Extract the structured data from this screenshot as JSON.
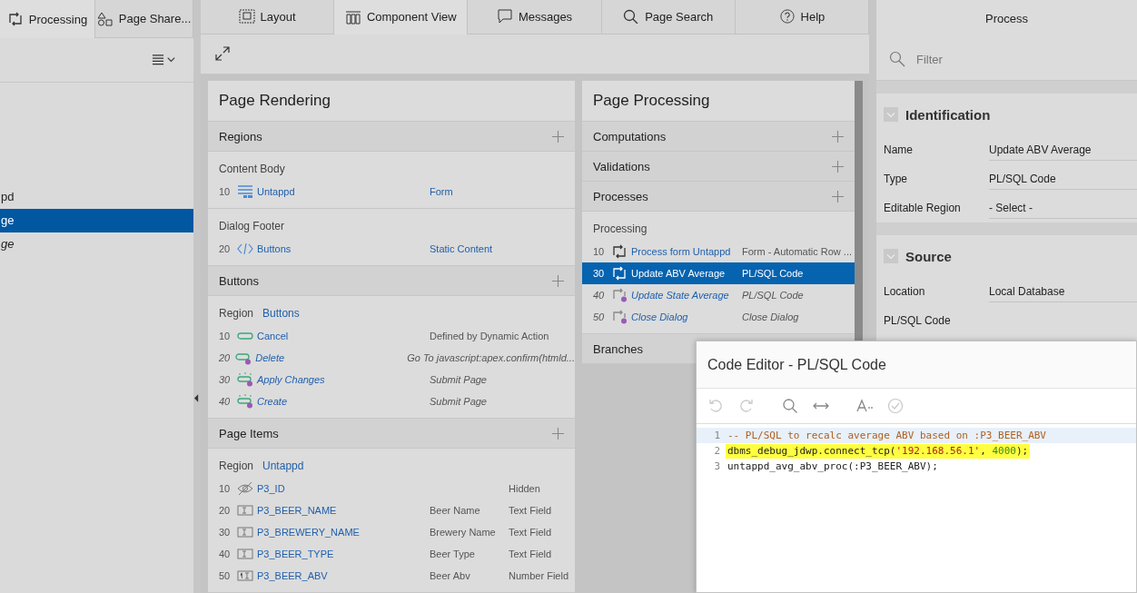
{
  "left_panel": {
    "tabs": [
      {
        "label": "Processing",
        "selected": true
      },
      {
        "label": "Page Share...",
        "selected": false
      }
    ],
    "tree_items": [
      {
        "label": "pd",
        "selected": false,
        "conditional": false
      },
      {
        "label": "ge",
        "selected": true,
        "conditional": false
      },
      {
        "label": "ge",
        "selected": false,
        "conditional": true
      }
    ]
  },
  "center_tabs": [
    {
      "label": "Layout",
      "selected": false
    },
    {
      "label": "Component View",
      "selected": true
    },
    {
      "label": "Messages",
      "selected": false
    },
    {
      "label": "Page Search",
      "selected": false
    },
    {
      "label": "Help",
      "selected": false
    }
  ],
  "page_rendering": {
    "title": "Page Rendering",
    "sections": [
      {
        "title": "Regions",
        "kind": "regions",
        "add_button": true,
        "groups": [
          {
            "title": "Content Body",
            "rows": [
              {
                "kind": "form",
                "seq": "10",
                "name": "Untappd",
                "type": "Form",
                "conditional": false
              }
            ]
          },
          {
            "title": "Dialog Footer",
            "rows": [
              {
                "kind": "static",
                "seq": "20",
                "name": "Buttons",
                "type": "Static Content",
                "conditional": false
              }
            ]
          }
        ]
      },
      {
        "title": "Buttons",
        "kind": "buttons",
        "add_button": true,
        "groups": [
          {
            "title": "Region",
            "link": "Buttons",
            "rows": [
              {
                "kind": "button",
                "seq": "10",
                "name": "Cancel",
                "type": "Defined by Dynamic Action",
                "conditional": false
              },
              {
                "kind": "button",
                "seq": "20",
                "name": "Delete",
                "type": "Go To javascript:apex.confirm(htmld...",
                "conditional": true
              },
              {
                "kind": "submit",
                "seq": "30",
                "name": "Apply Changes",
                "type": "Submit Page",
                "conditional": true
              },
              {
                "kind": "submit",
                "seq": "40",
                "name": "Create",
                "type": "Submit Page",
                "conditional": true
              }
            ]
          }
        ]
      },
      {
        "title": "Page Items",
        "kind": "items",
        "add_button": true,
        "groups": [
          {
            "title": "Region",
            "link": "Untappd",
            "rows": [
              {
                "kind": "hidden",
                "seq": "10",
                "name": "P3_ID",
                "type": "Hidden",
                "conditional": false
              },
              {
                "kind": "text",
                "seq": "20",
                "name": "P3_BEER_NAME",
                "label": "Beer Name",
                "type": "Text Field",
                "conditional": false
              },
              {
                "kind": "text",
                "seq": "30",
                "name": "P3_BREWERY_NAME",
                "label": "Brewery Name",
                "type": "Text Field",
                "conditional": false
              },
              {
                "kind": "text",
                "seq": "40",
                "name": "P3_BEER_TYPE",
                "label": "Beer Type",
                "type": "Text Field",
                "conditional": false
              },
              {
                "kind": "number",
                "seq": "50",
                "name": "P3_BEER_ABV",
                "label": "Beer Abv",
                "type": "Number Field",
                "conditional": false
              }
            ]
          }
        ]
      }
    ]
  },
  "page_processing": {
    "title": "Page Processing",
    "sections": [
      {
        "title": "Computations",
        "add_button": true
      },
      {
        "title": "Validations",
        "add_button": true
      },
      {
        "title": "Processes",
        "kind": "processes",
        "add_button": true,
        "groups": [
          {
            "title": "Processing",
            "rows": [
              {
                "kind": "process",
                "seq": "10",
                "name": "Process form Untappd",
                "type": "Form - Automatic Row ...",
                "conditional": false,
                "selected": false
              },
              {
                "kind": "process",
                "seq": "30",
                "name": "Update ABV Average",
                "type": "PL/SQL Code",
                "conditional": false,
                "selected": true
              },
              {
                "kind": "process",
                "seq": "40",
                "name": "Update State Average",
                "type": "PL/SQL Code",
                "conditional": true,
                "selected": false
              },
              {
                "kind": "process",
                "seq": "50",
                "name": "Close Dialog",
                "type": "Close Dialog",
                "conditional": true,
                "selected": false
              }
            ]
          }
        ]
      },
      {
        "title": "Branches"
      }
    ]
  },
  "property_editor": {
    "title": "Process",
    "filter": {
      "placeholder": "Filter"
    },
    "sections": [
      {
        "title": "Identification",
        "expanded": true,
        "properties": [
          {
            "label": "Name",
            "value": "Update ABV Average"
          },
          {
            "label": "Type",
            "value": "PL/SQL Code"
          },
          {
            "label": "Editable Region",
            "value": "- Select -"
          }
        ]
      },
      {
        "title": "Source",
        "expanded": true,
        "properties": [
          {
            "label": "Location",
            "value": "Local Database"
          },
          {
            "label": "PL/SQL Code"
          }
        ]
      }
    ]
  },
  "code_editor": {
    "title": "Code Editor - PL/SQL Code",
    "toolbar": [
      {
        "kind": "undo",
        "disabled": true
      },
      {
        "kind": "redo",
        "disabled": true
      },
      {
        "kind": "search",
        "disabled": false
      },
      {
        "kind": "swap",
        "disabled": false
      },
      {
        "kind": "font",
        "disabled": false
      },
      {
        "kind": "validate",
        "disabled": true
      }
    ],
    "lines": [
      {
        "number": "1",
        "current": true,
        "highlighted": false,
        "tokens": [
          {
            "kind": "comment",
            "text": "-- PL/SQL to recalc average ABV based on :P3_BEER_ABV"
          }
        ]
      },
      {
        "number": "2",
        "current": false,
        "highlighted": true,
        "tokens": [
          {
            "kind": "plain",
            "text": "dbms_debug_jdwp.connect_tcp("
          },
          {
            "kind": "string",
            "text": "'192.168.56.1'"
          },
          {
            "kind": "plain",
            "text": ", "
          },
          {
            "kind": "number",
            "text": "4000"
          },
          {
            "kind": "plain",
            "text": ");"
          }
        ]
      },
      {
        "number": "3",
        "current": false,
        "highlighted": false,
        "tokens": [
          {
            "kind": "plain",
            "text": "untappd_avg_abv_proc(:P3_BEER_ABV);"
          }
        ]
      }
    ]
  }
}
